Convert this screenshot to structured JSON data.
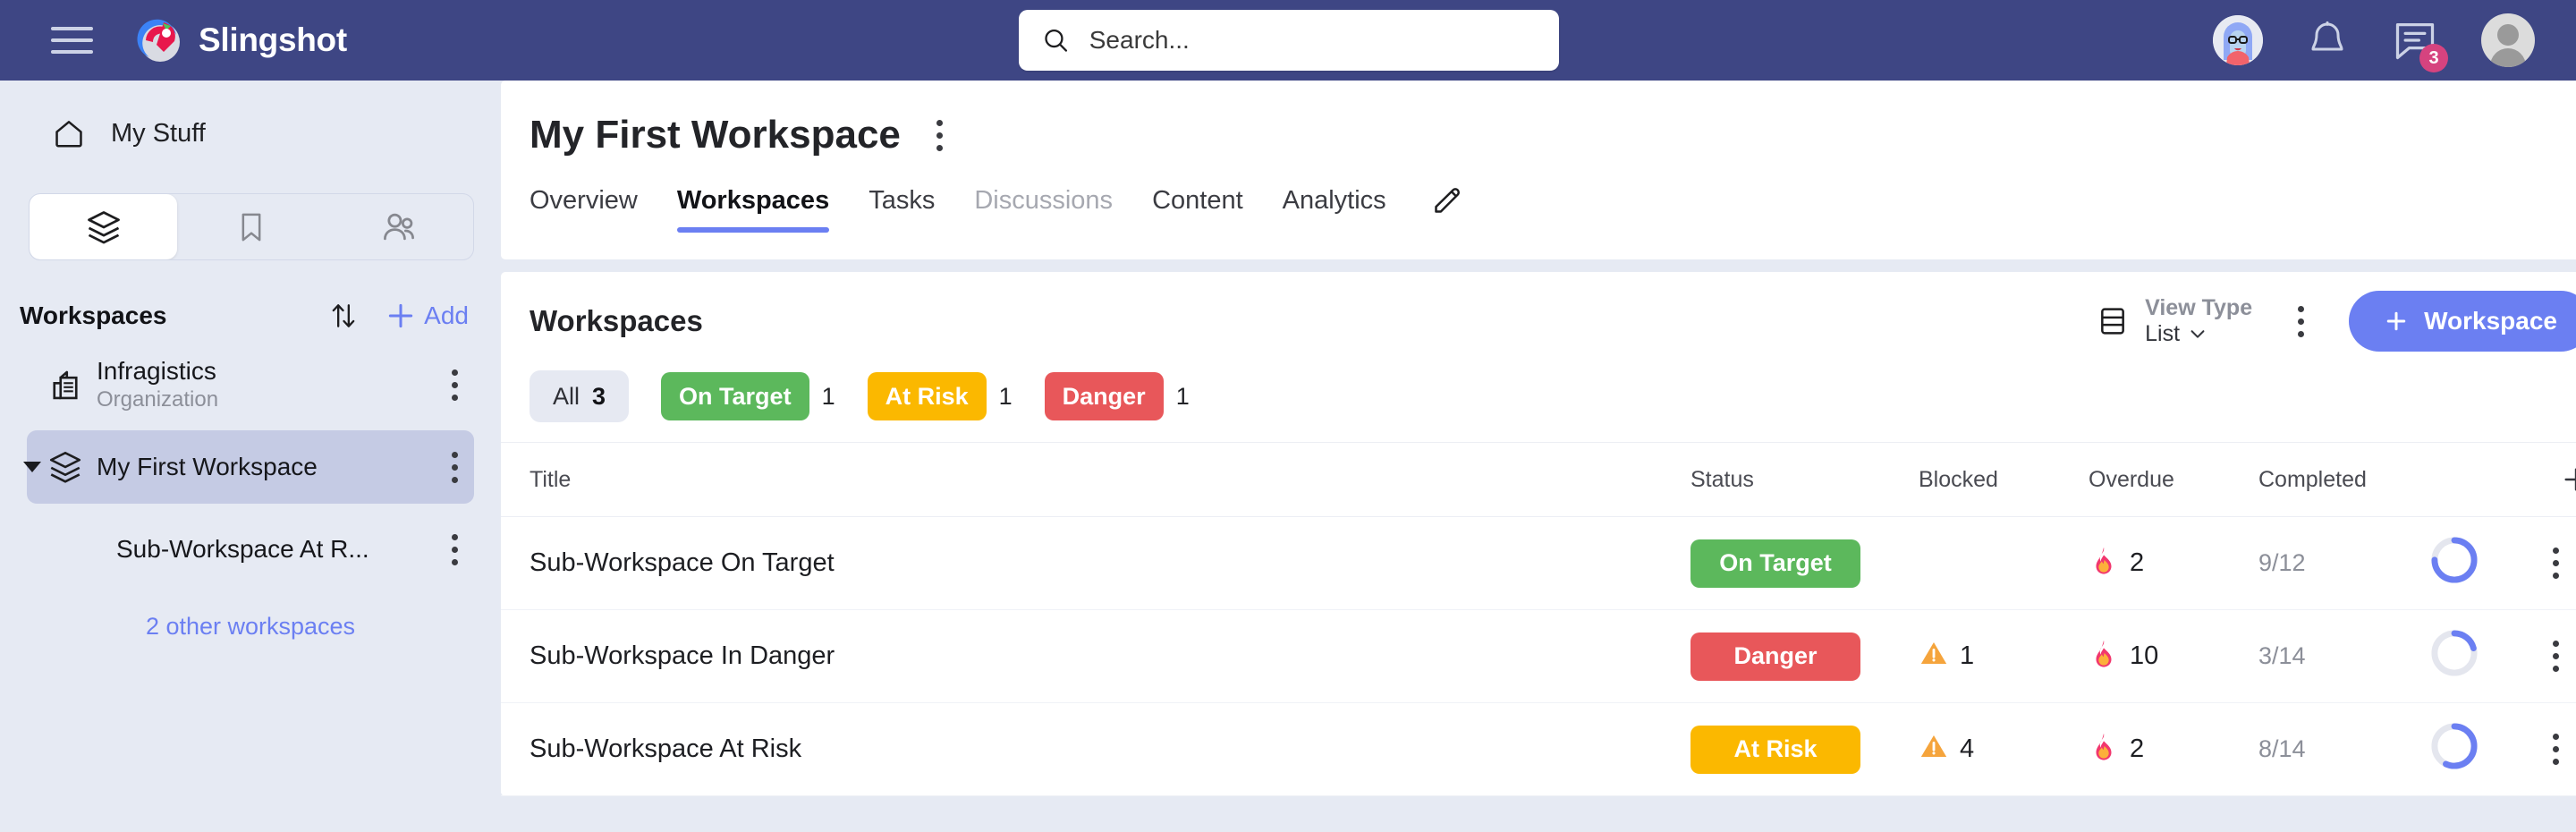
{
  "app": {
    "brand_name": "Slingshot",
    "menu_icon": "hamburger-icon",
    "logo_icon": "slingshot-rocket-logo"
  },
  "search": {
    "placeholder": "Search...",
    "value": "",
    "icon": "search-icon"
  },
  "topbar_actions": {
    "assistant_avatar_icon": "assistant-avatar-icon",
    "notifications_icon": "bell-icon",
    "messages_icon": "chat-icon",
    "messages_badge": "3",
    "profile_icon": "user-avatar-icon"
  },
  "sidebar": {
    "my_stuff": {
      "label": "My Stuff",
      "icon": "home-icon"
    },
    "tabs": [
      {
        "name": "workspaces",
        "icon": "layers-icon",
        "active": true
      },
      {
        "name": "bookmarks",
        "icon": "bookmark-icon",
        "active": false
      },
      {
        "name": "people",
        "icon": "people-icon",
        "active": false
      }
    ],
    "section_title": "Workspaces",
    "sort_icon": "sort-arrows-icon",
    "add_label": "Add",
    "add_icon": "plus-icon",
    "items": [
      {
        "name": "Infragistics",
        "subtitle": "Organization",
        "icon": "organization-building-icon",
        "selected": false,
        "expandable": false,
        "child": false
      },
      {
        "name": "My First Workspace",
        "subtitle": "",
        "icon": "layers-icon",
        "selected": true,
        "expandable": true,
        "child": false
      },
      {
        "name": "Sub-Workspace At R...",
        "subtitle": "",
        "icon": "",
        "selected": false,
        "expandable": false,
        "child": true
      }
    ],
    "other_workspaces_label": "2 other workspaces"
  },
  "header": {
    "title": "My First Workspace",
    "more_icon": "kebab-menu-icon",
    "edit_icon": "pencil-icon",
    "tabs": [
      {
        "label": "Overview",
        "active": false,
        "disabled": false
      },
      {
        "label": "Workspaces",
        "active": true,
        "disabled": false
      },
      {
        "label": "Tasks",
        "active": false,
        "disabled": false
      },
      {
        "label": "Discussions",
        "active": false,
        "disabled": true
      },
      {
        "label": "Content",
        "active": false,
        "disabled": false
      },
      {
        "label": "Analytics",
        "active": false,
        "disabled": false
      }
    ]
  },
  "grid": {
    "heading": "Workspaces",
    "view_type": {
      "label": "View Type",
      "value": "List",
      "icon": "list-view-icon",
      "chevron": "chevron-down-icon"
    },
    "more_icon": "kebab-menu-icon",
    "add_button": {
      "label": "Workspace",
      "icon": "plus-icon"
    },
    "filters": [
      {
        "label": "All",
        "count": "3",
        "style": "neutral"
      },
      {
        "label": "On Target",
        "count": "1",
        "style": "green"
      },
      {
        "label": "At Risk",
        "count": "1",
        "style": "amber"
      },
      {
        "label": "Danger",
        "count": "1",
        "style": "red"
      }
    ],
    "columns": [
      "Title",
      "Status",
      "Blocked",
      "Overdue",
      "Completed"
    ],
    "add_column_icon": "plus-icon",
    "rows": [
      {
        "title": "Sub-Workspace On Target",
        "status": "On Target",
        "status_style": "green",
        "blocked": "",
        "blocked_icon": "",
        "overdue": "2",
        "overdue_icon": "fire-icon",
        "completed": "9/12",
        "progress_percent": 75,
        "menu_icon": "kebab-menu-icon"
      },
      {
        "title": "Sub-Workspace In Danger",
        "status": "Danger",
        "status_style": "red",
        "blocked": "1",
        "blocked_icon": "warning-triangle-icon",
        "overdue": "10",
        "overdue_icon": "fire-icon",
        "completed": "3/14",
        "progress_percent": 21,
        "menu_icon": "kebab-menu-icon"
      },
      {
        "title": "Sub-Workspace At Risk",
        "status": "At Risk",
        "status_style": "amber",
        "blocked": "4",
        "blocked_icon": "warning-triangle-icon",
        "overdue": "2",
        "overdue_icon": "fire-icon",
        "completed": "8/14",
        "progress_percent": 57,
        "menu_icon": "kebab-menu-icon"
      }
    ]
  },
  "colors": {
    "header_navy": "#3e4684",
    "accent_blue": "#6b7ff2",
    "status_green": "#5cb85c",
    "status_amber": "#fbb800",
    "status_red": "#e8575a",
    "badge_pink": "#d6437f",
    "page_bg": "#e6eaf3"
  }
}
